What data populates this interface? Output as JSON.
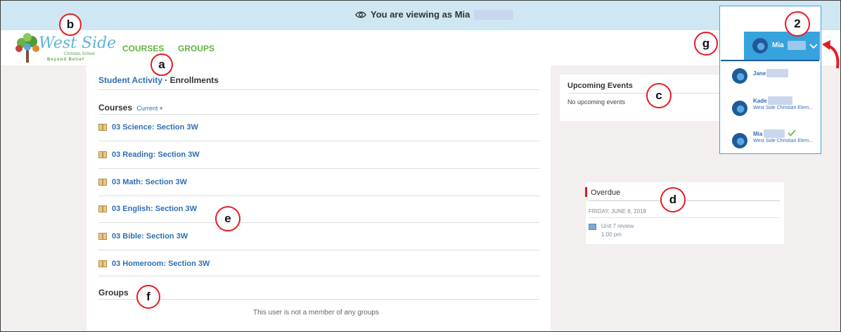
{
  "banner": {
    "text": "You are viewing as Mia",
    "icon": "eye-icon"
  },
  "logo": {
    "word": "West Side",
    "line1": "Christian School",
    "line2": "Beyond Belief"
  },
  "nav": {
    "courses": "COURSES",
    "groups": "GROUPS"
  },
  "main": {
    "breadcrumb_link": "Student Activity",
    "breadcrumb_current": "Enrollments",
    "courses_heading": "Courses",
    "courses_filter": "Current",
    "courses": [
      "03 Science: Section 3W",
      "03 Reading: Section 3W",
      "03 Math: Section 3W",
      "03 English: Section 3W",
      "03 Bible: Section 3W",
      "03 Homeroom: Section 3W"
    ],
    "groups_heading": "Groups",
    "groups_empty": "This user is not a member of any groups"
  },
  "upcoming": {
    "title": "Upcoming Events",
    "empty": "No upcoming events"
  },
  "overdue": {
    "title": "Overdue",
    "date": "FRIDAY, JUNE 8, 2018",
    "item": "Unit 7 review",
    "time": "1:00 pm"
  },
  "account": {
    "current_user": "Mia",
    "children": [
      {
        "name": "Jane",
        "school": ""
      },
      {
        "name": "Kade",
        "school": "West Side Christian Elem..."
      },
      {
        "name": "Mia",
        "school": "West Side Christian Elem..."
      }
    ]
  },
  "callouts": {
    "a": "a",
    "b": "b",
    "c": "c",
    "d": "d",
    "e": "e",
    "f": "f",
    "g": "g",
    "two": "2"
  },
  "colors": {
    "nav_green": "#64b341",
    "link_blue": "#2f6fb4",
    "banner": "#cfe7f3",
    "accent": "#36a3dd",
    "callout": "#e51b23"
  }
}
